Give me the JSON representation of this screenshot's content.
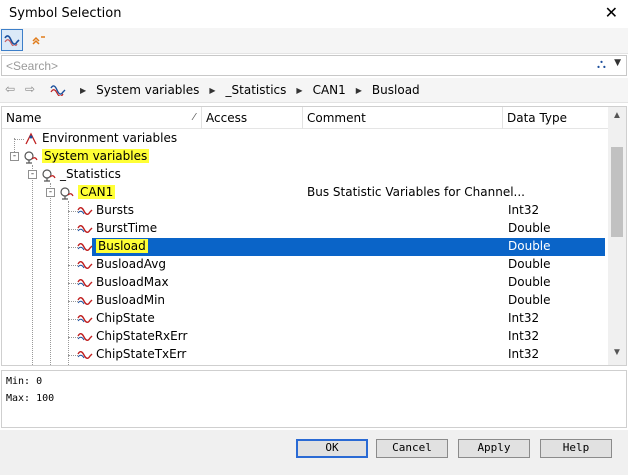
{
  "window": {
    "title": "Symbol Selection",
    "close_glyph": "✕"
  },
  "toolbar": {
    "signal_icon": "signal-wave-icon",
    "filter_icon": "filter-up-icon"
  },
  "search": {
    "placeholder": "<Search>"
  },
  "breadcrumb": {
    "segments": [
      "System variables",
      "_Statistics",
      "CAN1",
      "Busload"
    ]
  },
  "columns": {
    "name": "Name",
    "access": "Access",
    "comment": "Comment",
    "data_type": "Data Type"
  },
  "tree": [
    {
      "label": "Environment variables",
      "comment": "",
      "type": ""
    },
    {
      "label": "System variables",
      "comment": "",
      "type": "",
      "highlight": true
    },
    {
      "label": "_Statistics",
      "comment": "",
      "type": ""
    },
    {
      "label": "CAN1",
      "comment": "Bus Statistic Variables for Channel...",
      "type": "",
      "highlight": true
    },
    {
      "label": "Bursts",
      "comment": "",
      "type": "Int32"
    },
    {
      "label": "BurstTime",
      "comment": "",
      "type": "Double"
    },
    {
      "label": "Busload",
      "comment": "",
      "type": "Double",
      "selected": true,
      "highlight": true
    },
    {
      "label": "BusloadAvg",
      "comment": "",
      "type": "Double"
    },
    {
      "label": "BusloadMax",
      "comment": "",
      "type": "Double"
    },
    {
      "label": "BusloadMin",
      "comment": "",
      "type": "Double"
    },
    {
      "label": "ChipState",
      "comment": "",
      "type": "Int32"
    },
    {
      "label": "ChipStateRxErr",
      "comment": "",
      "type": "Int32"
    },
    {
      "label": "ChipStateTxErr",
      "comment": "",
      "type": "Int32"
    }
  ],
  "info": {
    "min": "Min:  0",
    "max": "Max:  100"
  },
  "buttons": {
    "ok": "OK",
    "cancel": "Cancel",
    "apply": "Apply",
    "help": "Help"
  },
  "colors": {
    "selection": "#0a64c8",
    "highlight": "#ffff36",
    "accent": "#2a6ad4"
  }
}
